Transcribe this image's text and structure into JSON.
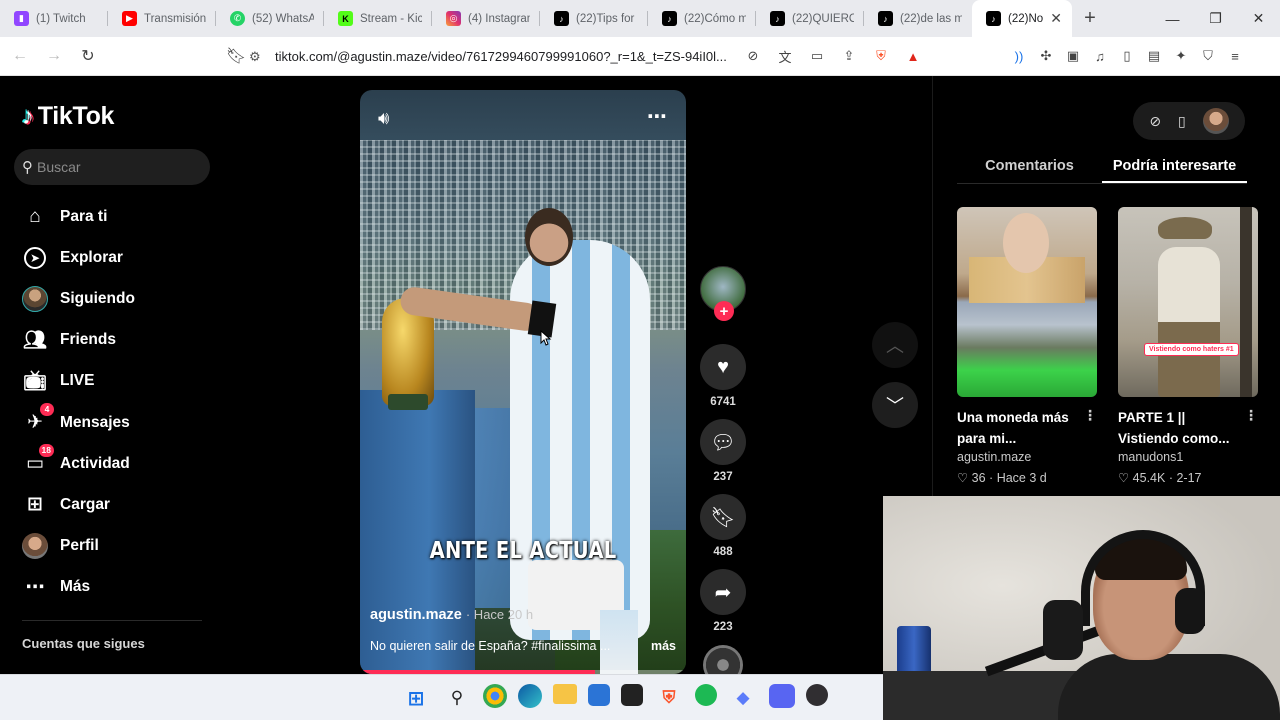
{
  "browser": {
    "tabs": [
      {
        "label": "(1) Twitch",
        "icon": "twitch-icon",
        "color": "#9146ff"
      },
      {
        "label": "Transmisión",
        "icon": "youtube-icon",
        "color": "#ff0000"
      },
      {
        "label": "(52) WhatsA",
        "icon": "whatsapp-icon",
        "color": "#25d366"
      },
      {
        "label": "Stream - Kic",
        "icon": "kick-icon",
        "color": "#53fc18"
      },
      {
        "label": "(4) Instagran",
        "icon": "instagram-icon",
        "color": "#e1306c"
      },
      {
        "label": "(22)Tips for",
        "icon": "tiktok-icon",
        "color": "#000000"
      },
      {
        "label": "(22)Cómo m",
        "icon": "tiktok-icon",
        "color": "#000000"
      },
      {
        "label": "(22)QUIERO",
        "icon": "tiktok-icon",
        "color": "#000000"
      },
      {
        "label": "(22)de las m",
        "icon": "tiktok-icon",
        "color": "#000000"
      },
      {
        "label": "(22)No",
        "icon": "tiktok-icon",
        "color": "#000000",
        "active": true
      }
    ],
    "url": "tiktok.com/@agustin.maze/video/7617299460799991060?_r=1&_t=ZS-94iI0l..."
  },
  "sidebar": {
    "logo": "TikTok",
    "search_placeholder": "Buscar",
    "items": [
      {
        "label": "Para ti",
        "icon": "home-icon"
      },
      {
        "label": "Explorar",
        "icon": "compass-icon"
      },
      {
        "label": "Siguiendo",
        "icon": "following-avatar-icon"
      },
      {
        "label": "Friends",
        "icon": "friends-icon"
      },
      {
        "label": "LIVE",
        "icon": "live-icon"
      },
      {
        "label": "Mensajes",
        "icon": "messages-icon",
        "badge": "4"
      },
      {
        "label": "Actividad",
        "icon": "activity-icon",
        "badge": "18"
      },
      {
        "label": "Cargar",
        "icon": "upload-icon"
      },
      {
        "label": "Perfil",
        "icon": "profile-avatar-icon"
      },
      {
        "label": "Más",
        "icon": "more-icon"
      }
    ],
    "following_title": "Cuentas que sigues"
  },
  "video": {
    "overlay_text": "ANTE EL ACTUAL",
    "author": "agustin.maze",
    "time": "· Hace 20 h",
    "description": "No quieren salir de España? #finalissima ...",
    "more_label": "más",
    "progress": 0.72
  },
  "actions": {
    "likes": "6741",
    "comments": "237",
    "saves": "488",
    "shares": "223"
  },
  "right_panel": {
    "tabs": [
      "Comentarios",
      "Podría interesarte"
    ],
    "active_tab": 1,
    "recs": [
      {
        "title": "Una moneda más para mi...",
        "author": "agustin.maze",
        "stats": "♡ 36 · Hace 3 d"
      },
      {
        "title": "PARTE 1 || Vistiendo como...",
        "author": "manudons1",
        "stats": "♡ 45.4K · 2-17",
        "overlay": "Vistiendo como haters #1"
      }
    ]
  }
}
